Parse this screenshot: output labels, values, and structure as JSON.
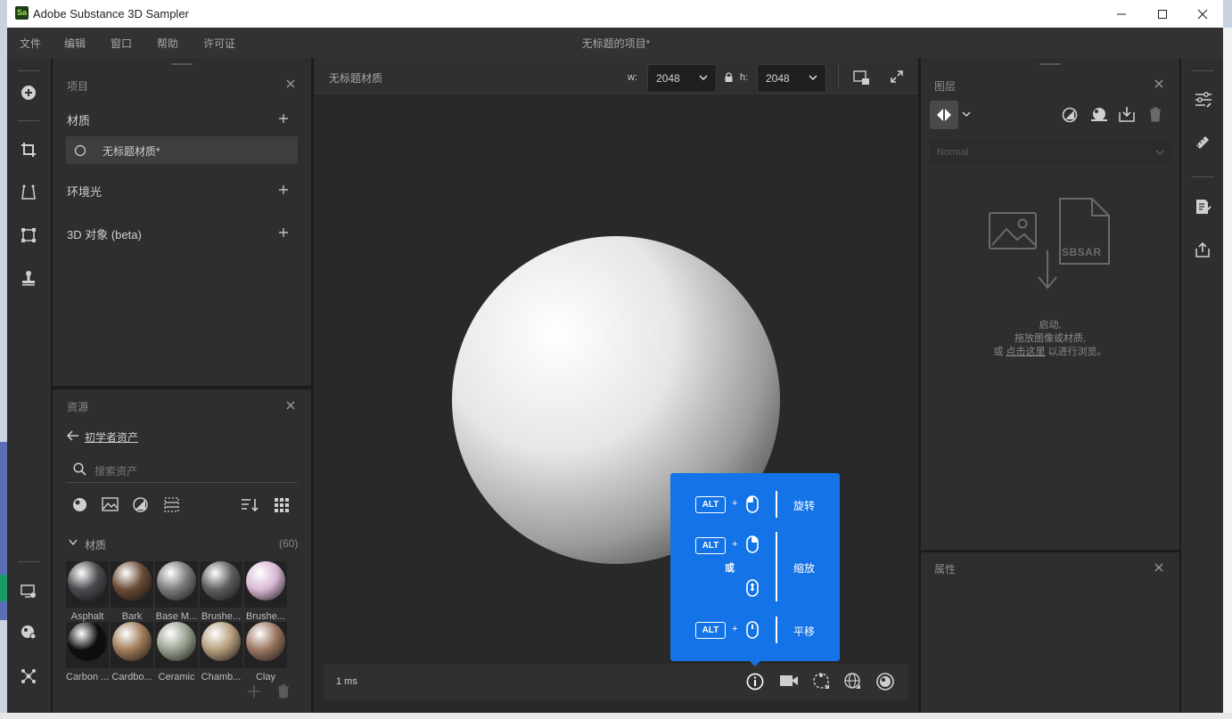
{
  "window": {
    "app_title": "Adobe Substance 3D Sampler",
    "logo_text": "Sa"
  },
  "menu": {
    "items": [
      "文件",
      "编辑",
      "窗口",
      "帮助",
      "许可证"
    ],
    "project_title": "无标题的项目*"
  },
  "project_panel": {
    "title": "项目",
    "materials_label": "材质",
    "selected_material": "无标题材质*",
    "environment_label": "环境光",
    "objects_label": "3D 对象 (beta)"
  },
  "assets_panel": {
    "title": "资源",
    "breadcrumb": "初学者资产",
    "search_placeholder": "搜索资产",
    "section_label": "材质",
    "section_count": "(60)",
    "items": [
      {
        "label": "Asphalt",
        "color": "#4a4b4f"
      },
      {
        "label": "Bark",
        "color": "#6a4a36"
      },
      {
        "label": "Base M...",
        "color": "#7a7b7c"
      },
      {
        "label": "Brushe...",
        "color": "#5d5e60"
      },
      {
        "label": "Brushe...",
        "color": "#d8b8d4"
      },
      {
        "label": "Carbon ...",
        "color": "#0d0d0d"
      },
      {
        "label": "Cardbo...",
        "color": "#a07a58"
      },
      {
        "label": "Ceramic",
        "color": "#97a18f"
      },
      {
        "label": "Chamb...",
        "color": "#b59d7c"
      },
      {
        "label": "Clay",
        "color": "#9a7660"
      }
    ]
  },
  "viewport": {
    "material_title": "无标题材质",
    "width_label": "w:",
    "width_value": "2048",
    "height_label": "h:",
    "height_value": "2048",
    "status_time": "1 ms"
  },
  "tooltip": {
    "key_label": "ALT",
    "plus": "+",
    "or": "或",
    "rotate": "旋转",
    "zoom": "缩放",
    "pan": "平移"
  },
  "layers_panel": {
    "title": "图层",
    "blend_mode": "Normal",
    "sbsar_label": "SBSAR",
    "empty_line1": "启动,",
    "empty_line2": "拖放图像或材质,",
    "empty_line3_prefix": "或",
    "empty_link": "点击这里",
    "empty_line3_suffix": "以进行浏览。"
  },
  "properties_panel": {
    "title": "属性"
  },
  "colors": {
    "accent_blue": "#1473e6",
    "panel_bg": "#2e2e2e",
    "viewport_bg": "#292929"
  }
}
